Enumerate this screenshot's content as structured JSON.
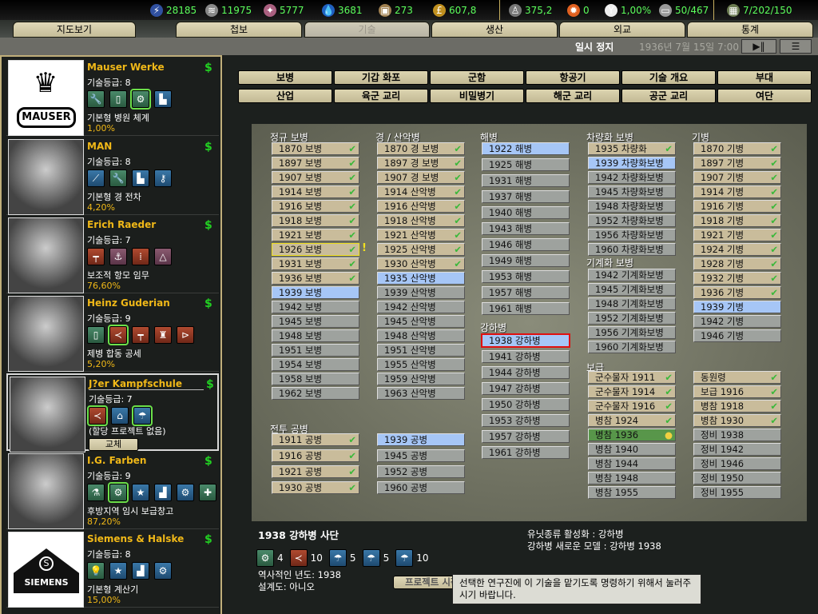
{
  "resources": [
    {
      "icon": "energy-icon",
      "value": "28185"
    },
    {
      "icon": "metal-icon",
      "value": "11975"
    },
    {
      "icon": "rare-materials-icon",
      "value": "5777"
    },
    {
      "icon": "oil-icon",
      "value": "3681"
    },
    {
      "icon": "supplies-icon",
      "value": "273"
    },
    {
      "icon": "money-icon",
      "value": "607,8"
    },
    {
      "icon": "manpower-icon",
      "value": "375,2"
    },
    {
      "icon": "nuclear-icon",
      "value": "0"
    },
    {
      "icon": "dissent-icon",
      "value": "1,00%"
    },
    {
      "icon": "transport-icon",
      "value": "50/467"
    },
    {
      "icon": "ic-icon",
      "value": "7/202/150"
    }
  ],
  "tabs": [
    {
      "label": "지도보기"
    },
    {
      "label": "첩보"
    },
    {
      "label": "기술"
    },
    {
      "label": "생산"
    },
    {
      "label": "외교"
    },
    {
      "label": "통계"
    }
  ],
  "status": {
    "paused": "일시 정지",
    "date": "1936년 7월 15일 7:00"
  },
  "researchers": [
    {
      "name": "Mauser Werke",
      "skill": "기술등급: 8",
      "project": "기본형 병원 체계",
      "progress": "1,00%",
      "logo": "MAUSER",
      "icons": [
        {
          "n": "wrench-icon",
          "c": "g",
          "g": "🔧"
        },
        {
          "n": "book-icon",
          "c": "g",
          "g": "▯"
        },
        {
          "n": "blueprint-gear-icon",
          "c": "g",
          "g": "⚙",
          "hl": true
        },
        {
          "n": "bar-chart-icon",
          "c": "b",
          "g": "▙"
        }
      ]
    },
    {
      "name": "MAN",
      "skill": "기술등급: 8",
      "project": "기본형 경 전차",
      "progress": "4,20%",
      "icons": [
        {
          "n": "crane-icon",
          "c": "b",
          "g": "⟋"
        },
        {
          "n": "wrench-icon",
          "c": "g",
          "g": "🔧"
        },
        {
          "n": "bar-chart-icon",
          "c": "b",
          "g": "▙"
        },
        {
          "n": "key-gear-icon",
          "c": "b",
          "g": "⚷"
        }
      ]
    },
    {
      "name": "Erich Raeder",
      "skill": "기술등급: 7",
      "project": "보조적 항모 임무",
      "progress": "76,60%",
      "icons": [
        {
          "n": "hierarchy-icon",
          "c": "r",
          "g": "┯"
        },
        {
          "n": "anchor-icon",
          "c": "p",
          "g": "⚓"
        },
        {
          "n": "formation-icon",
          "c": "r",
          "g": "⁞"
        },
        {
          "n": "sextant-icon",
          "c": "p",
          "g": "△"
        }
      ]
    },
    {
      "name": "Heinz Guderian",
      "skill": "기술등급: 9",
      "project": "제병 합동 공세",
      "progress": "5,20%",
      "icons": [
        {
          "n": "book-icon",
          "c": "g",
          "g": "▯"
        },
        {
          "n": "tactics-arrow-icon",
          "c": "r",
          "g": "≺",
          "hl": true
        },
        {
          "n": "hierarchy-icon",
          "c": "r",
          "g": "┯"
        },
        {
          "n": "infantry-tank-icon",
          "c": "r",
          "g": "♜"
        },
        {
          "n": "tank-arrow-icon",
          "c": "r",
          "g": "⊳"
        }
      ]
    },
    {
      "name": "J?er Kampfschule",
      "skill": "기술등급: 7",
      "project": "(할당 프로젝트 없음)",
      "replace": "교체",
      "icons": [
        {
          "n": "tactics-arrow-icon",
          "c": "r",
          "g": "≺",
          "hl": true
        },
        {
          "n": "infantry-building-icon",
          "c": "b",
          "g": "⌂"
        },
        {
          "n": "paratrooper-icon",
          "c": "b",
          "g": "☂",
          "hl": true
        }
      ]
    },
    {
      "name": "I.G. Farben",
      "skill": "기술등급: 9",
      "project": "후방지역 임시 보급창고",
      "progress": "87,20%",
      "icons": [
        {
          "n": "flask-icon",
          "c": "g",
          "g": "⚗"
        },
        {
          "n": "blueprint-gear-icon",
          "c": "g",
          "g": "⚙",
          "hl": true
        },
        {
          "n": "star-icon",
          "c": "b",
          "g": "★"
        },
        {
          "n": "factory-icon",
          "c": "b",
          "g": "▟"
        },
        {
          "n": "gears-icon",
          "c": "b",
          "g": "⚙"
        },
        {
          "n": "medical-cross-icon",
          "c": "g",
          "g": "✚"
        }
      ]
    },
    {
      "name": "Siemens & Halske",
      "skill": "기술등급: 8",
      "project": "기본형 계산기",
      "progress": "15,00%",
      "logo": "SIEMENS",
      "icons": [
        {
          "n": "lightbulb-icon",
          "c": "g",
          "g": "💡"
        },
        {
          "n": "star-icon",
          "c": "b",
          "g": "★"
        },
        {
          "n": "factory-icon",
          "c": "b",
          "g": "▟"
        },
        {
          "n": "gears-icon",
          "c": "b",
          "g": "⚙"
        }
      ]
    }
  ],
  "categories": [
    "보병",
    "기갑 화포",
    "군함",
    "항공기",
    "기술 개요",
    "부대",
    "산업",
    "육군 교리",
    "비밀병기",
    "해군 교리",
    "공군 교리",
    "여단"
  ],
  "tech_groups": [
    {
      "heading": "정규 보병",
      "items": [
        [
          "1870 보병",
          "done"
        ],
        [
          "1897 보병",
          "done"
        ],
        [
          "1907 보병",
          "done"
        ],
        [
          "1914 보병",
          "done"
        ],
        [
          "1916 보병",
          "done"
        ],
        [
          "1918 보병",
          "done"
        ],
        [
          "1921 보병",
          "done"
        ],
        [
          "1926 보병",
          "done warn"
        ],
        [
          "1931 보병",
          "done"
        ],
        [
          "1936 보병",
          "done"
        ],
        [
          "1939 보병",
          "avail"
        ],
        [
          "1942 보병",
          "locked"
        ],
        [
          "1945 보병",
          "locked"
        ],
        [
          "1948 보병",
          "locked"
        ],
        [
          "1951 보병",
          "locked"
        ],
        [
          "1954 보병",
          "locked"
        ],
        [
          "1958 보병",
          "locked"
        ],
        [
          "1962 보병",
          "locked"
        ]
      ]
    },
    {
      "heading": "경 / 산악병",
      "items": [
        [
          "1870 경 보병",
          "done"
        ],
        [
          "1897 경 보병",
          "done"
        ],
        [
          "1907 경 보병",
          "done"
        ],
        [
          "1914 산악병",
          "done"
        ],
        [
          "1916 산악병",
          "done"
        ],
        [
          "1918 산악병",
          "done"
        ],
        [
          "1921 산악병",
          "done"
        ],
        [
          "1925 산악병",
          "done"
        ],
        [
          "1930 산악병",
          "done"
        ],
        [
          "1935 산악병",
          "avail"
        ],
        [
          "1939 산악병",
          "locked"
        ],
        [
          "1942 산악병",
          "locked"
        ],
        [
          "1945 산악병",
          "locked"
        ],
        [
          "1948 산악병",
          "locked"
        ],
        [
          "1951 산악병",
          "locked"
        ],
        [
          "1955 산악병",
          "locked"
        ],
        [
          "1959 산악병",
          "locked"
        ],
        [
          "1963 산악병",
          "locked"
        ]
      ]
    },
    {
      "heading": "전투 공병",
      "items": [
        [
          "1911 공병",
          "done"
        ],
        [
          "1916 공병",
          "done"
        ],
        [
          "1921 공병",
          "done"
        ],
        [
          "1930 공병",
          "done"
        ]
      ]
    },
    {
      "heading": "",
      "items": [
        [
          "1939 공병",
          "avail"
        ],
        [
          "1945 공병",
          "locked"
        ],
        [
          "1952 공병",
          "locked"
        ],
        [
          "1960 공병",
          "locked"
        ]
      ]
    },
    {
      "heading": "해병",
      "items": [
        [
          "1922 해병",
          "avail"
        ],
        [
          "1925 해병",
          "locked"
        ],
        [
          "1931 해병",
          "locked"
        ],
        [
          "1937 해병",
          "locked"
        ],
        [
          "1940 해병",
          "locked"
        ],
        [
          "1943 해병",
          "locked"
        ],
        [
          "1946 해병",
          "locked"
        ],
        [
          "1949 해병",
          "locked"
        ],
        [
          "1953 해병",
          "locked"
        ],
        [
          "1957 해병",
          "locked"
        ],
        [
          "1961 해병",
          "locked"
        ]
      ]
    },
    {
      "heading": "강하병",
      "items": [
        [
          "1938 강하병",
          "avail sel"
        ],
        [
          "1941 강하병",
          "locked"
        ],
        [
          "1944 강하병",
          "locked"
        ],
        [
          "1947 강하병",
          "locked"
        ],
        [
          "1950 강하병",
          "locked"
        ],
        [
          "1953 강하병",
          "locked"
        ],
        [
          "1957 강하병",
          "locked"
        ],
        [
          "1961 강하병",
          "locked"
        ]
      ]
    },
    {
      "heading": "차량화 보병",
      "items": [
        [
          "1935 차량화",
          "done"
        ],
        [
          "1939 차량화보병",
          "avail"
        ],
        [
          "1942 차량화보병",
          "locked"
        ],
        [
          "1945 차량화보병",
          "locked"
        ],
        [
          "1948 차량화보병",
          "locked"
        ],
        [
          "1952 차량화보병",
          "locked"
        ],
        [
          "1956 차량화보병",
          "locked"
        ],
        [
          "1960 차량화보병",
          "locked"
        ]
      ]
    },
    {
      "heading": "기계화 보병",
      "items": [
        [
          "1942 기계화보병",
          "locked"
        ],
        [
          "1945 기계화보병",
          "locked"
        ],
        [
          "1948 기계화보병",
          "locked"
        ],
        [
          "1952 기계화보병",
          "locked"
        ],
        [
          "1956 기계화보병",
          "locked"
        ],
        [
          "1960 기계화보병",
          "locked"
        ]
      ]
    },
    {
      "heading": "보급",
      "items": [
        [
          "군수물자 1911",
          "done"
        ],
        [
          "군수물자 1914",
          "done"
        ],
        [
          "군수물자 1916",
          "done"
        ],
        [
          "병참 1924",
          "done"
        ],
        [
          "병참 1936",
          "active"
        ],
        [
          "병참 1940",
          "locked"
        ],
        [
          "병참 1944",
          "locked"
        ],
        [
          "병참 1948",
          "locked"
        ],
        [
          "병참 1955",
          "locked"
        ]
      ]
    },
    {
      "heading": "기병",
      "items": [
        [
          "1870 기병",
          "done"
        ],
        [
          "1897 기병",
          "done"
        ],
        [
          "1907 기병",
          "done"
        ],
        [
          "1914 기병",
          "done"
        ],
        [
          "1916 기병",
          "done"
        ],
        [
          "1918 기병",
          "done"
        ],
        [
          "1921 기병",
          "done"
        ],
        [
          "1924 기병",
          "done"
        ],
        [
          "1928 기병",
          "done"
        ],
        [
          "1932 기병",
          "done"
        ],
        [
          "1936 기병",
          "done"
        ],
        [
          "1939 기병",
          "avail"
        ],
        [
          "1942 기병",
          "locked"
        ],
        [
          "1946 기병",
          "locked"
        ]
      ]
    },
    {
      "heading": "",
      "items": [
        [
          "동원령",
          "done"
        ],
        [
          "보급 1916",
          "done"
        ],
        [
          "병참 1918",
          "done"
        ],
        [
          "병참 1930",
          "done"
        ],
        [
          "정비 1938",
          "locked"
        ],
        [
          "정비 1942",
          "locked"
        ],
        [
          "정비 1946",
          "locked"
        ],
        [
          "정비 1950",
          "locked"
        ],
        [
          "정비 1955",
          "locked"
        ]
      ]
    }
  ],
  "warning_mark": "!",
  "info": {
    "title": "1938 강하병 사단",
    "requirements": [
      {
        "icon": "blueprint-gear-icon",
        "c": "g",
        "g": "⚙",
        "v": "4"
      },
      {
        "icon": "tactics-arrow-icon",
        "c": "r",
        "g": "≺",
        "v": "10"
      },
      {
        "icon": "paratrooper-icon",
        "c": "b",
        "g": "☂",
        "v": "5"
      },
      {
        "icon": "paratrooper-icon",
        "c": "b",
        "g": "☂",
        "v": "5"
      },
      {
        "icon": "paratrooper-icon",
        "c": "b",
        "g": "☂",
        "v": "10"
      }
    ],
    "historical_year": "역사적인 년도: 1938",
    "blueprint": "설계도: 아니오",
    "effect1": "유닛종류 활성화 : 강하병",
    "effect2": "강하병  새로운 모델 : 강하병 1938",
    "start_button": "프로젝트 시작",
    "tooltip": "선택한 연구진에 이 기술을 맡기도록 명령하기 위해서 눌러주시기 바랍니다."
  }
}
